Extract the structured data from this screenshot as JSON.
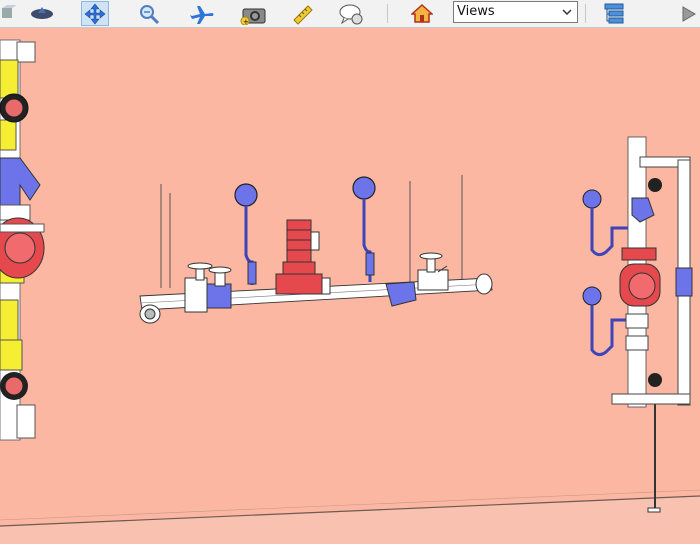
{
  "toolbar": {
    "tools": [
      {
        "name": "view-orient-icon"
      },
      {
        "name": "pan-icon",
        "active": true
      },
      {
        "name": "zoom-icon"
      },
      {
        "name": "fly-mode-icon"
      },
      {
        "name": "camera-icon"
      },
      {
        "name": "measure-ruler-icon"
      },
      {
        "name": "markup-comment-icon"
      },
      {
        "name": "home-icon"
      },
      {
        "name": "structure-tree-icon"
      },
      {
        "name": "next-arrow-icon"
      }
    ],
    "views_select": {
      "value": "Views",
      "options": [
        "Views"
      ]
    }
  },
  "colors": {
    "background": "#fbb7a2",
    "pipe": "#ffffff",
    "component_blue": "#6d74ea",
    "pump_red": "#e5484d",
    "fitting_yellow": "#f6ee33"
  }
}
